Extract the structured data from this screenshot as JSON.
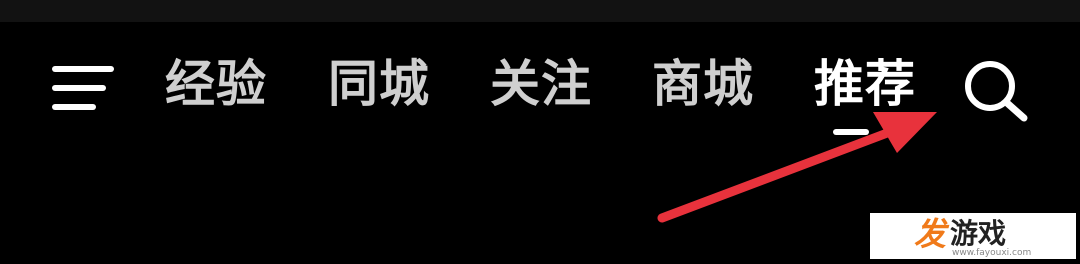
{
  "nav": {
    "menu_icon": "hamburger-menu-icon",
    "tabs": [
      {
        "label": "经验",
        "active": false
      },
      {
        "label": "同城",
        "active": false
      },
      {
        "label": "关注",
        "active": false
      },
      {
        "label": "商城",
        "active": false
      },
      {
        "label": "推荐",
        "active": true
      }
    ],
    "search_icon": "search-icon"
  },
  "annotation": {
    "arrow_color": "#e8323c"
  },
  "watermark": {
    "logo": "发",
    "text": "游戏",
    "url": "www.fayouxi.com"
  },
  "colors": {
    "background": "#000000",
    "tab_inactive": "#cfcfcf",
    "tab_active": "#ffffff"
  }
}
